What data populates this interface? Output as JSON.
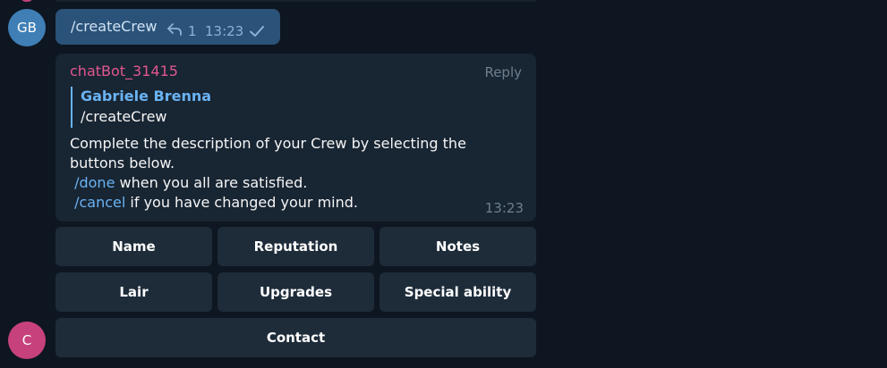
{
  "outgoing": {
    "avatar_initials": "GB",
    "text": "/createCrew",
    "reply_count": "1",
    "time": "13:23"
  },
  "incoming": {
    "sender": "chatBot_31415",
    "reply_label": "Reply",
    "quote": {
      "author": "Gabriele Brenna",
      "text": "/createCrew"
    },
    "body_line1": "Complete the description of your Crew by selecting the buttons below.",
    "cmd_done": "/done",
    "done_suffix": " when you all are satisfied.",
    "cmd_cancel": "/cancel",
    "cancel_suffix": " if you have changed your mind.",
    "time": "13:23"
  },
  "keyboard": {
    "name": "Name",
    "reputation": "Reputation",
    "notes": "Notes",
    "lair": "Lair",
    "upgrades": "Upgrades",
    "special_ability": "Special ability",
    "contact": "Contact"
  },
  "bot_avatar_initials": "C",
  "colors": {
    "background": "#0e1621",
    "outgoing_bubble": "#2b5278",
    "incoming_bubble": "#182533",
    "keyboard_button": "#1e2c3a",
    "sender_name": "#e0578e",
    "link": "#6ab3f3"
  },
  "icons": {
    "reply": "reply-arrow-icon",
    "read_status": "checkmark-icon"
  }
}
